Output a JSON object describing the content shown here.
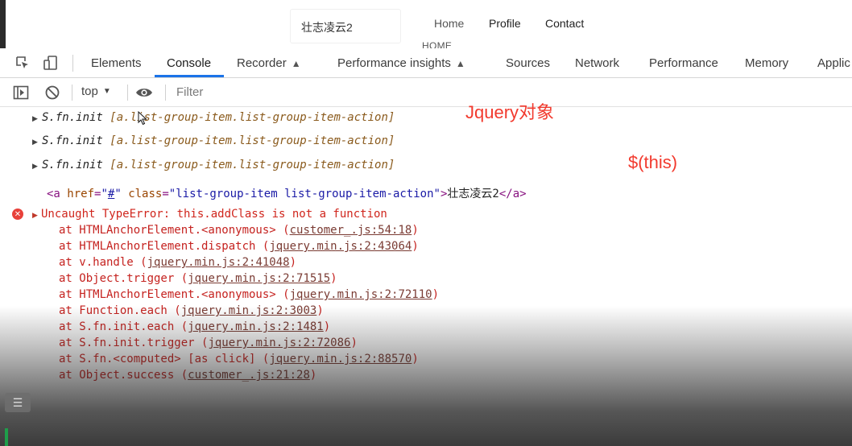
{
  "webpage": {
    "title": "壮志凌云2",
    "nav": [
      "Home",
      "Profile",
      "Contact"
    ],
    "home_heading_cut": "HOME"
  },
  "devtools": {
    "tabs": [
      "Elements",
      "Console",
      "Recorder",
      "Performance insights",
      "Sources",
      "Network",
      "Performance",
      "Memory",
      "Applic"
    ],
    "active_tab": "Console",
    "flask_tabs": [
      "Recorder",
      "Performance insights"
    ],
    "accent_color": "#1a73e8"
  },
  "console_toolbar": {
    "context": "top",
    "filter_placeholder": "Filter"
  },
  "console": {
    "object_rows": [
      {
        "prefix": "S.fn.init ",
        "selector": "[a.list-group-item.list-group-item-action]"
      },
      {
        "prefix": "S.fn.init ",
        "selector": "[a.list-group-item.list-group-item-action]"
      },
      {
        "prefix": "S.fn.init ",
        "selector": "[a.list-group-item.list-group-item-action]"
      }
    ],
    "html_row": {
      "open": "<a",
      "href_attr": "href",
      "href_value": "#",
      "class_attr": "class",
      "class_value": "list-group-item list-group-item-action",
      "text": "壮志凌云2",
      "close": "</a>"
    },
    "error": {
      "message": "Uncaught TypeError: this.addClass is not a function",
      "frames": [
        {
          "fn": "at HTMLAnchorElement.<anonymous> ",
          "loc": "customer_.js:54:18"
        },
        {
          "fn": "at HTMLAnchorElement.dispatch ",
          "loc": "jquery.min.js:2:43064"
        },
        {
          "fn": "at v.handle ",
          "loc": "jquery.min.js:2:41048"
        },
        {
          "fn": "at Object.trigger ",
          "loc": "jquery.min.js:2:71515"
        },
        {
          "fn": "at HTMLAnchorElement.<anonymous> ",
          "loc": "jquery.min.js:2:72110"
        },
        {
          "fn": "at Function.each ",
          "loc": "jquery.min.js:2:3003"
        },
        {
          "fn": "at S.fn.init.each ",
          "loc": "jquery.min.js:2:1481"
        },
        {
          "fn": "at S.fn.init.trigger ",
          "loc": "jquery.min.js:2:72086"
        },
        {
          "fn": "at S.fn.<computed> [as click] ",
          "loc": "jquery.min.js:2:88570"
        },
        {
          "fn": "at Object.success ",
          "loc": "customer_.js:21:28"
        }
      ]
    }
  },
  "annotations": {
    "jquery_obj": "Jquery对象",
    "this_wrap": "$(this)",
    "color": "#f23a2e"
  },
  "icons": [
    "inspect-icon",
    "device-toolbar-icon",
    "flask-icon",
    "sidebar-toggle-icon",
    "clear-console-icon",
    "dropdown-arrow-icon",
    "eye-icon",
    "error-icon",
    "expand-triangle-icon",
    "drawer-icon"
  ]
}
